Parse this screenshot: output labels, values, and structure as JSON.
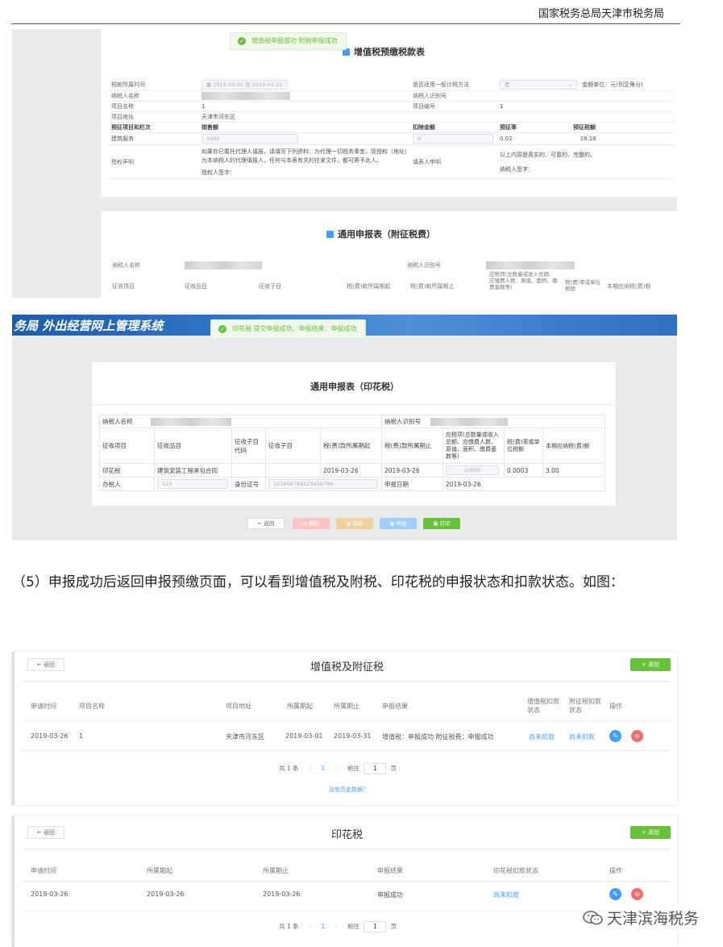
{
  "header": {
    "org": "国家税务总局天津市税务局"
  },
  "shot1": {
    "toast": "增值税申报成功 附税申报成功",
    "title": "增值税预缴税款表",
    "rows": {
      "period_label": "税款所属时间",
      "period_from": "2019-03-01",
      "period_sep": "至",
      "period_to": "2019-03-31",
      "general_method_label": "是否适用一般计税方法",
      "general_method_value": "是",
      "amount_unit": "金额单位：元(列至角分)",
      "taxpayer_name_label": "纳税人名称",
      "taxpayer_id_label": "纳税人识别号",
      "project_name_label": "项目名称",
      "project_name_value": "1",
      "project_no_label": "项目编号",
      "project_no_value": "1",
      "project_addr_label": "项目地址",
      "project_addr_value": "天津市河东区",
      "col_item": "预征项目和栏次",
      "col_sales": "销售额",
      "col_deduct": "扣除金额",
      "col_rate": "预征率",
      "col_tax": "预征税额",
      "item_name": "建筑服务",
      "sales_value": "1000",
      "deduct_value": "0",
      "rate_value": "0.02",
      "tax_value": "18.18",
      "auth_label": "授权声明",
      "auth_text": "如果你已委托代理人填报，请填写下列资料：为代理一切税务事宜，现授权（地址）为本纳税人的代理填报人，任何与本表有关的往来文件，都可寄予此人。",
      "auth_sign": "授权人签字：",
      "declarant_label": "填表人申明",
      "declarant_text": "以上内容是真实的、可靠的、完整的。",
      "taxpayer_sign": "纳税人签字："
    },
    "card2_title": "通用申报表（附征税费）",
    "card2": {
      "name_label": "纳税人名称",
      "id_label": "纳税人识别号",
      "cols": [
        "征收项目",
        "征收品目",
        "征收子目",
        "税(费)款所属期起",
        "税(费)款所属期止",
        "应税项(总数量或收入总额、应缴费人数、原值、面积、缴费基数等)",
        "税(费)率或单位税额",
        "本期应纳税(费)额"
      ]
    }
  },
  "shot2": {
    "brand_prefix": "务局",
    "brand_name": "外出经营网上管理系统",
    "toast": "印花税 提交申报成功，申报结果：申报成功",
    "title": "通用申报表（印花税）",
    "name_label": "纳税人名称",
    "id_label": "纳税人识别号",
    "cols": [
      "征收项目",
      "征收品目",
      "征收子目代码",
      "征收子目",
      "税(费)款所属期起",
      "税(费)款所属期止",
      "应税项(总数量或收入总额、应缴费人数、原值、面积、缴费基数等)",
      "税(费)率或单位税额",
      "本期应纳税(费)额"
    ],
    "row": [
      "印花税",
      "建筑安装工程承包合同",
      "",
      "",
      "2019-03-26",
      "2019-03-26",
      "10000",
      "0.0003",
      "3.00"
    ],
    "handler_label": "办税人",
    "handler_value": "123",
    "idcard_label": "身份证号",
    "idcard_value": "123456789123456789",
    "date_label": "申报日期",
    "date_value": "2019-03-26",
    "buttons": {
      "back": "← 返回",
      "delete": "删除",
      "save": "保存",
      "submit": "申报",
      "print": "打印"
    }
  },
  "paragraph": "（5）申报成功后返回申报预缴页面，可以看到增值税及附税、印花税的申报状态和扣款状态。如图：",
  "shot3": {
    "back": "← 返回",
    "title": "增值税及附征税",
    "add": "+ 添加",
    "headers": [
      "申请时间",
      "项目名称",
      "项目地址",
      "所属期起",
      "所属期止",
      "申报结果",
      "增值税扣款状态",
      "附征税扣款状态",
      "操作"
    ],
    "row": [
      "2019-03-26",
      "1",
      "天津市河东区",
      "2019-03-01",
      "2019-03-31",
      "增值税：申报成功 附征税费：申报成功",
      "尚未扣款",
      "尚未扣款"
    ],
    "pager": {
      "total": "共 1 条",
      "page": "1",
      "goto": "前往",
      "unit": "页"
    },
    "history": "没有历史数据？"
  },
  "shot4": {
    "back": "← 返回",
    "title": "印花税",
    "add": "+ 添加",
    "headers": [
      "申请时间",
      "所属期起",
      "所属期止",
      "申报结果",
      "印花税扣款状态",
      "操作"
    ],
    "row": [
      "2019-03-26",
      "2019-03-26",
      "2019-03-26",
      "申报成功",
      "尚未扣款"
    ],
    "pager": {
      "total": "共 1 条",
      "page": "1",
      "goto": "前往",
      "unit": "页"
    }
  },
  "watermark": "天津滨海税务",
  "colors": {
    "accent": "#409eff",
    "success": "#67c23a",
    "danger": "#f56c6c",
    "banner": "#2e74c4"
  }
}
